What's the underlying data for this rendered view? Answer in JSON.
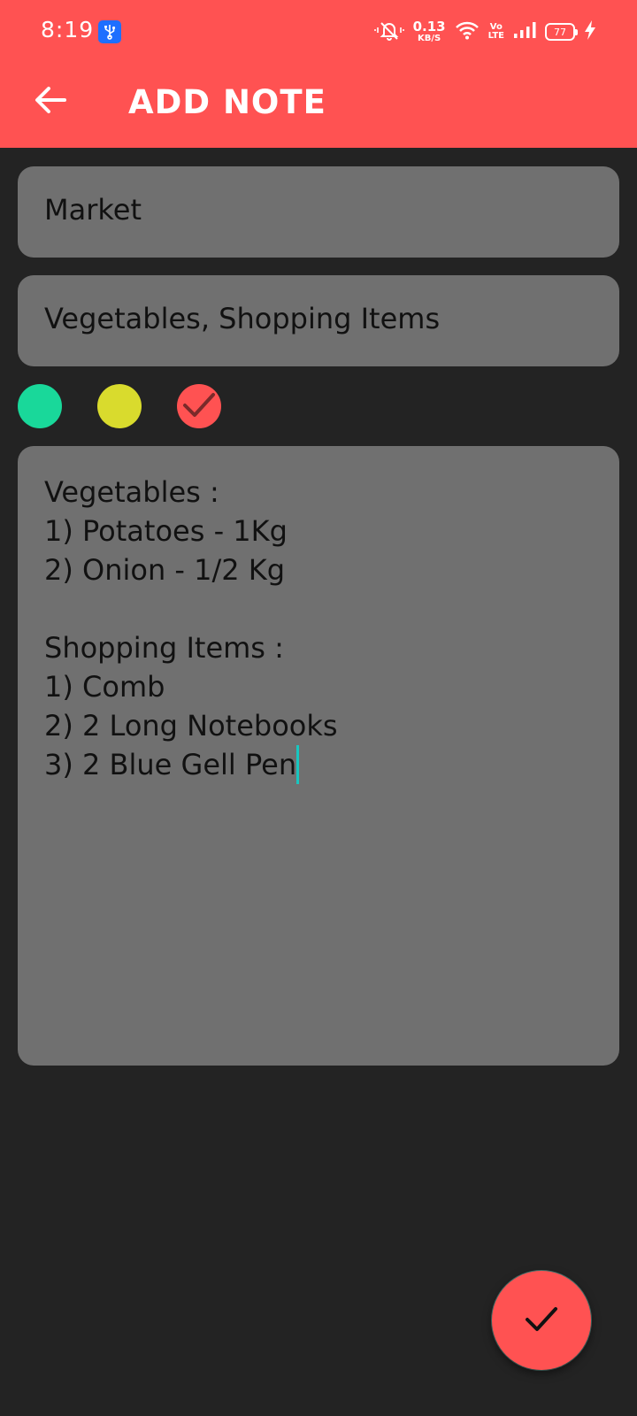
{
  "status_bar": {
    "time": "8:19",
    "net_speed_value": "0.13",
    "net_speed_unit": "KB/S",
    "volte_top": "Vo",
    "volte_bottom": "LTE",
    "battery_level": "77",
    "icons": [
      "usb-icon",
      "mute-bell-icon",
      "wifi-icon",
      "volte-icon",
      "signal-icon",
      "battery-icon",
      "charging-icon"
    ]
  },
  "app_bar": {
    "title": "ADD NOTE",
    "back_icon": "arrow-left-icon"
  },
  "form": {
    "title_value": "Market",
    "subtitle_value": "Vegetables, Shopping Items",
    "note_lines": [
      "Vegetables :",
      "1) Potatoes - 1Kg",
      "2) Onion - 1/2 Kg",
      "",
      "Shopping Items :",
      "1) Comb",
      "2) 2 Long Notebooks",
      "3) 2 Blue Gell Pen"
    ]
  },
  "color_options": [
    {
      "name": "green",
      "color": "#19D89A",
      "selected": false
    },
    {
      "name": "yellow",
      "color": "#D9DB2D",
      "selected": false
    },
    {
      "name": "red",
      "color": "#FF5252",
      "selected": true
    }
  ],
  "fab": {
    "icon": "check-icon"
  },
  "colors": {
    "accent": "#FF5252",
    "background": "#232323",
    "field": "#707070",
    "cursor": "#18C6C0"
  }
}
